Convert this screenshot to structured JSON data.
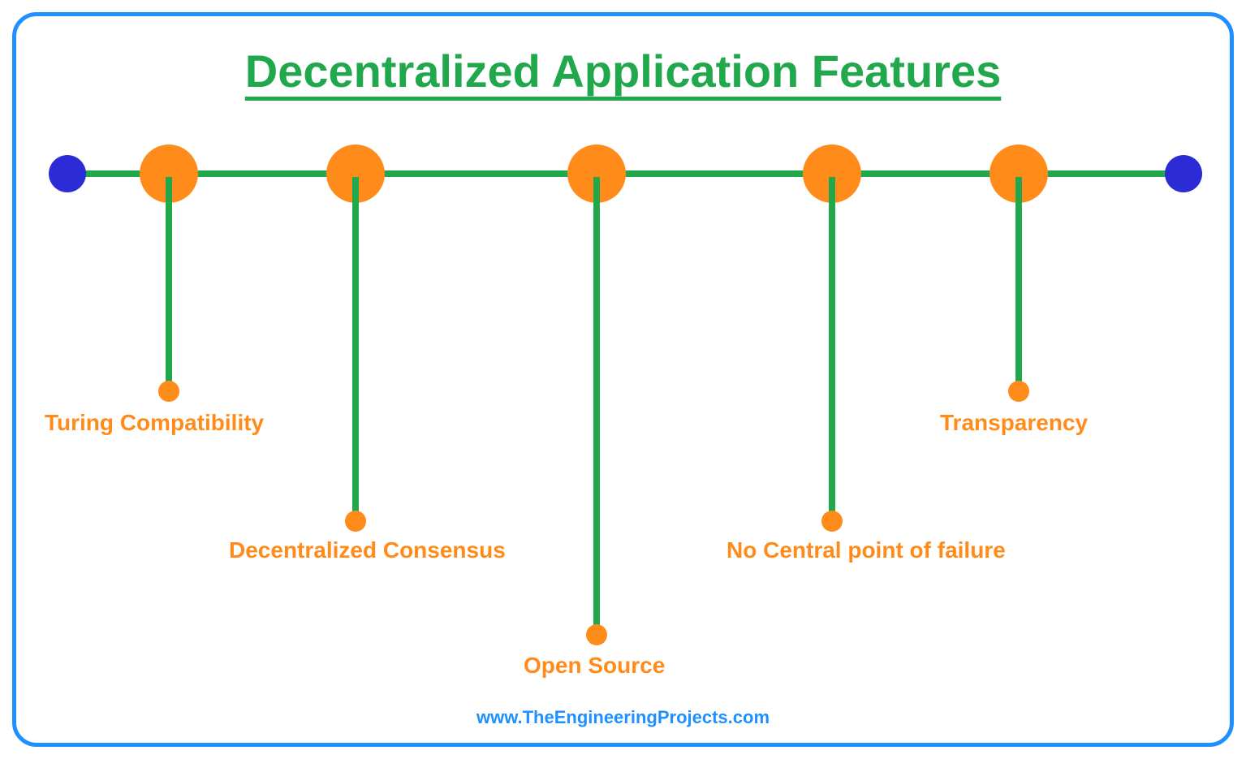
{
  "title": "Decentralized Application Features",
  "features": {
    "f1": "Turing Compatibility",
    "f2": "Decentralized Consensus",
    "f3": "Open Source",
    "f4": "No Central point of failure",
    "f5": "Transparency"
  },
  "footer": "www.TheEngineeringProjects.com",
  "colors": {
    "border": "#1E90FF",
    "green": "#21a84c",
    "orange": "#ff8c1a",
    "blue": "#2c2cd6"
  }
}
